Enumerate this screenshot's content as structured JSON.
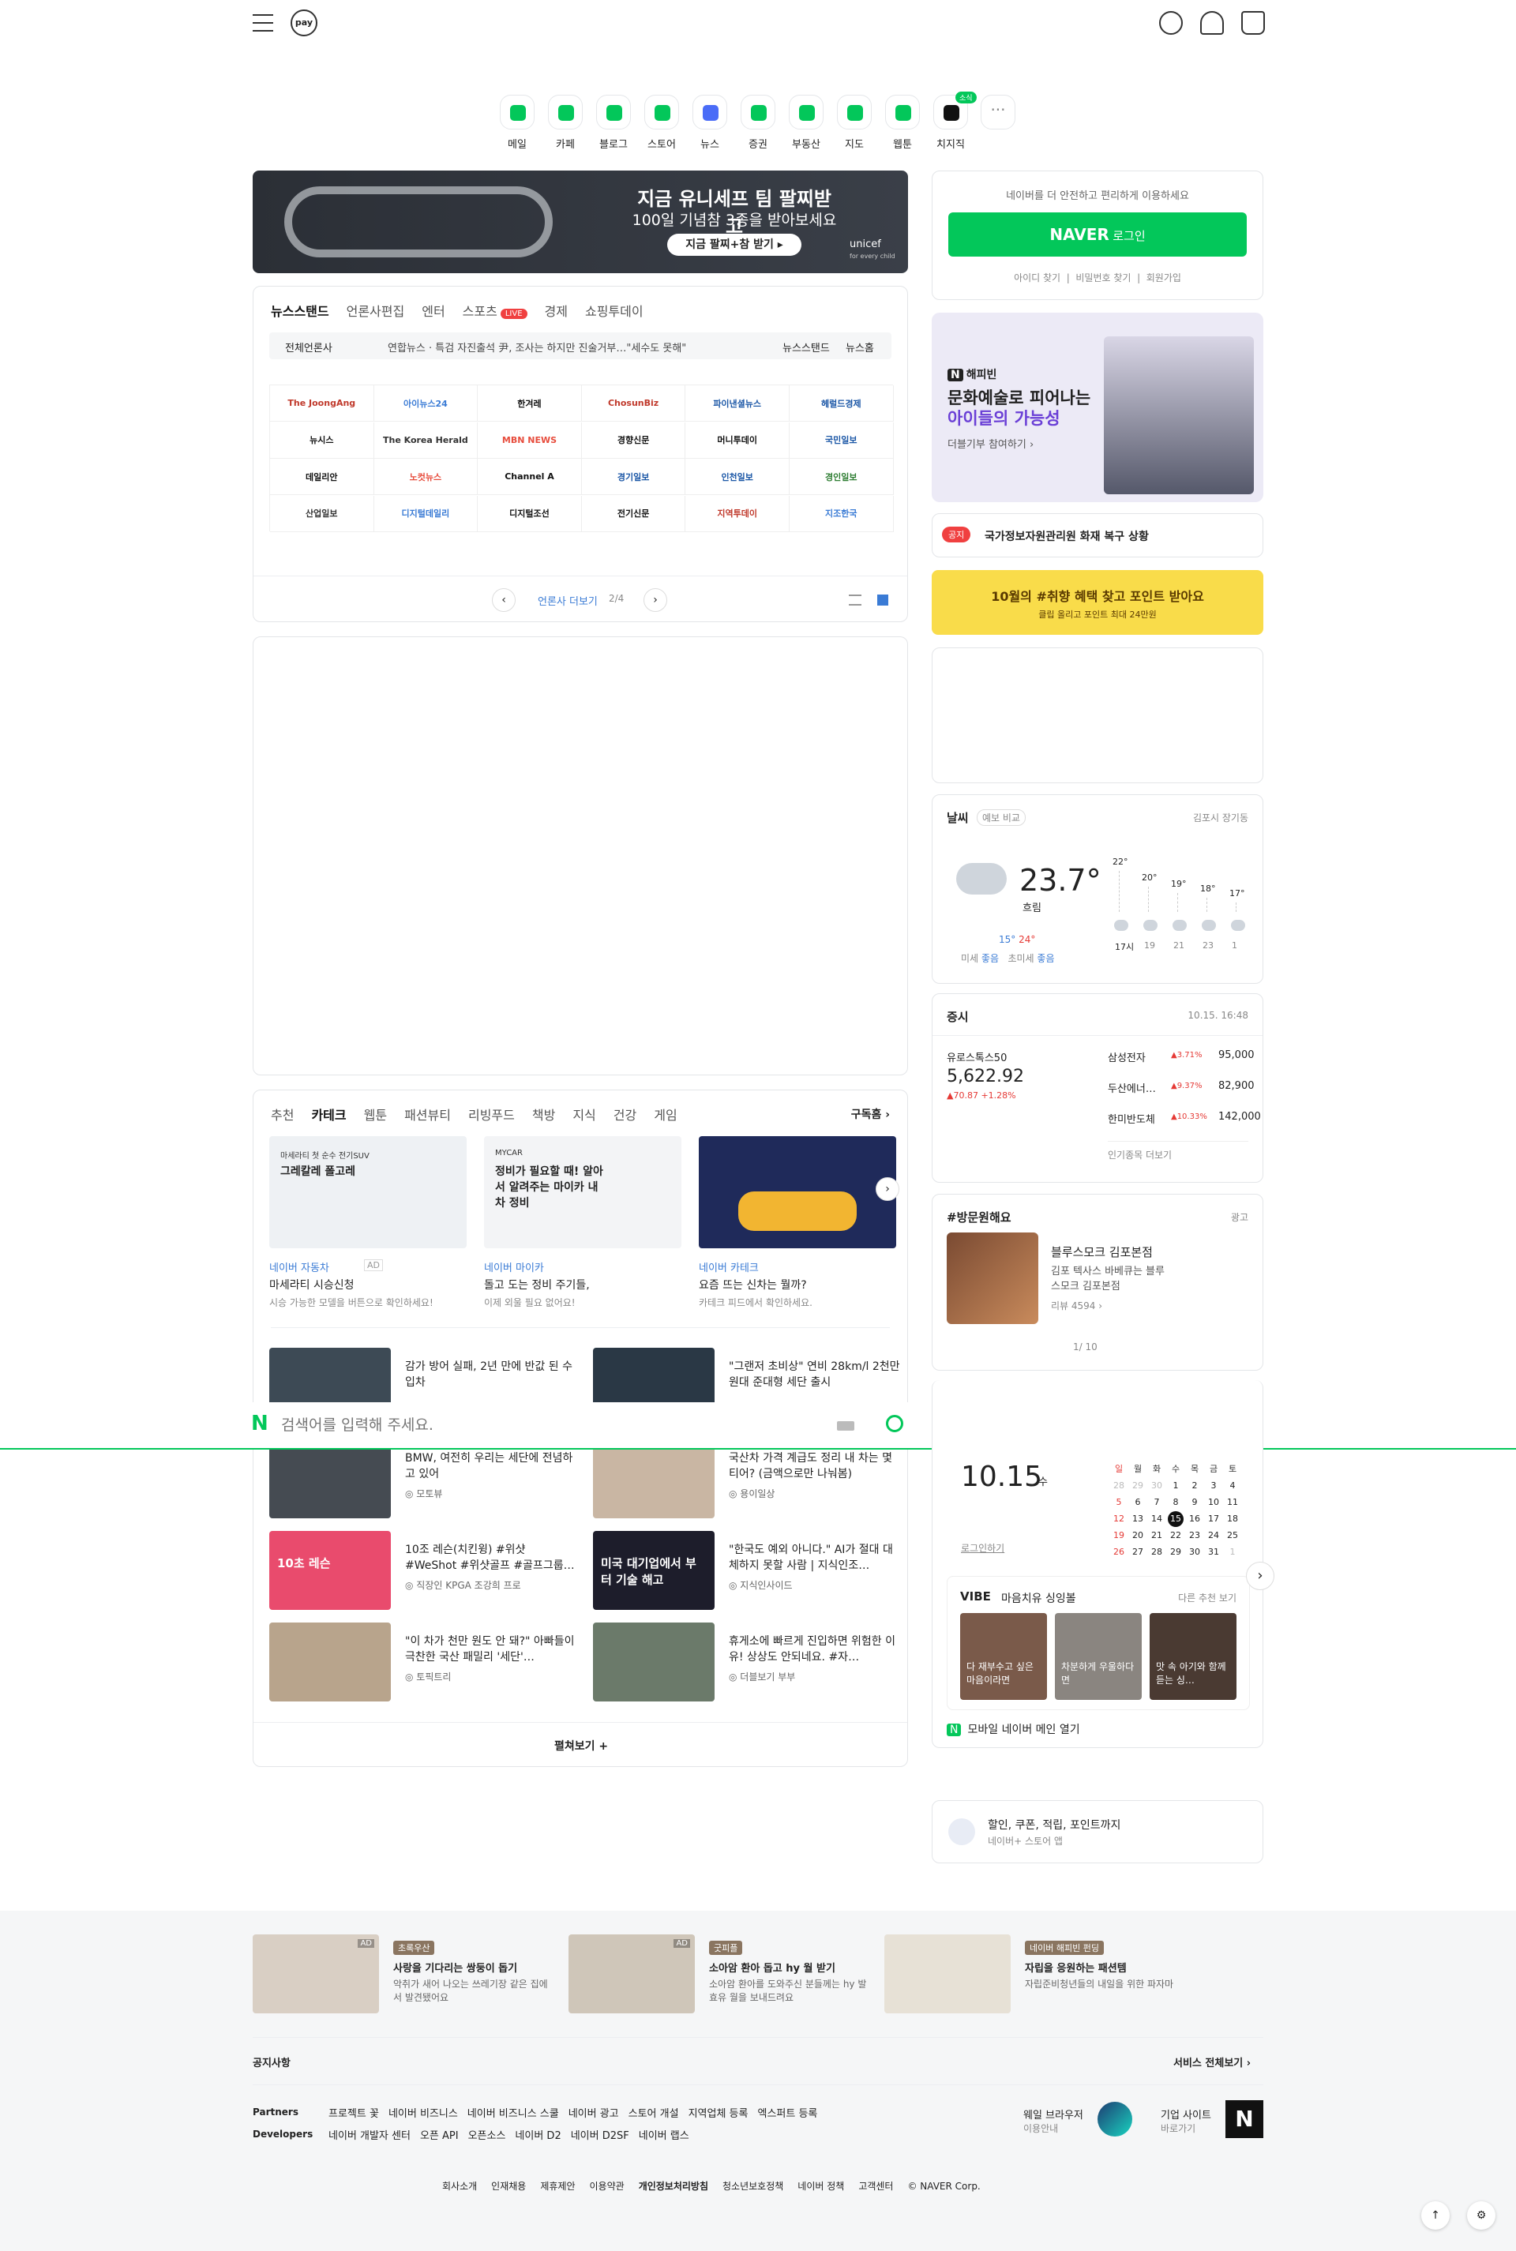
{
  "header": {
    "pay_label": "pay"
  },
  "services": [
    {
      "label": "메일",
      "color": "#03c75a"
    },
    {
      "label": "카페",
      "color": "#03c75a"
    },
    {
      "label": "블로그",
      "color": "#03c75a"
    },
    {
      "label": "스토어",
      "color": "#03c75a"
    },
    {
      "label": "뉴스",
      "color": "#4a6cf7"
    },
    {
      "label": "증권",
      "color": "#03c75a"
    },
    {
      "label": "부동산",
      "color": "#03c75a"
    },
    {
      "label": "지도",
      "color": "#03c75a"
    },
    {
      "label": "웹툰",
      "color": "#03c75a"
    },
    {
      "label": "치지직",
      "color": "#111111"
    }
  ],
  "services_badge": "소식",
  "banner": {
    "title": "지금 유니세프 팀 팔찌받고",
    "subtitle": "100일 기념참 3종을 받아보세요",
    "cta": "지금 팔찌+참 받기 ▸",
    "brand": "unicef",
    "brand_sub": "for every child"
  },
  "login": {
    "info": "네이버를 더 안전하고 편리하게 이용하세요",
    "button_brand": "NAVER",
    "button_label": "로그인",
    "find_id": "아이디 찾기",
    "find_pw": "비밀번호 찾기",
    "signup": "회원가입"
  },
  "news": {
    "tabs": [
      "뉴스스탠드",
      "언론사편집",
      "엔터",
      "스포츠",
      "경제",
      "쇼핑투데이"
    ],
    "live_label": "LIVE",
    "filter": "전체언론사",
    "headline": "연합뉴스 · 특검 자진출석 尹, 조사는 하지만 진술거부…\"세수도 못해\"",
    "link1": "뉴스스탠드",
    "link2": "뉴스홈",
    "logos": [
      "The JoongAng",
      "아이뉴스24",
      "한겨레",
      "ChosunBiz",
      "파이낸셜뉴스",
      "헤럴드경제",
      "뉴시스",
      "The Korea Herald",
      "MBN NEWS",
      "경향신문",
      "머니투데이",
      "국민일보",
      "데일리안",
      "노컷뉴스",
      "Channel A",
      "경기일보",
      "인천일보",
      "경인일보",
      "산업일보",
      "디지털데일리",
      "디지털조선",
      "전기신문",
      "지역투데이",
      "지조한국"
    ],
    "pager_label": "언론사 더보기",
    "pager_count": "2/4"
  },
  "happybean": {
    "brand": "해피빈",
    "line1": "문화예술로 피어나는",
    "line2": "아이들의 가능성",
    "cta": "더블기부 참여하기 ›"
  },
  "notice": {
    "badge": "공지",
    "text": "국가정보자원관리원 화재 복구 상황"
  },
  "promo": {
    "text": "10월의 #취향 혜택 찾고 포인트 받아요",
    "sub": "클립 올리고 포인트 최대 24만원"
  },
  "weather": {
    "title": "날씨",
    "compare": "예보 비교",
    "location": "김포시 장기동",
    "temp": "23.7°",
    "cond": "흐림",
    "low": "15°",
    "high": "24°",
    "dust_label": "미세",
    "dust_val": "좋음",
    "ufine_label": "초미세",
    "ufine_val": "좋음",
    "forecast": [
      {
        "t": "22°",
        "h": "17시"
      },
      {
        "t": "20°",
        "h": "19"
      },
      {
        "t": "19°",
        "h": "21"
      },
      {
        "t": "18°",
        "h": "23"
      },
      {
        "t": "17°",
        "h": "1"
      }
    ]
  },
  "stock": {
    "title": "증시",
    "time": "10.15. 16:48",
    "index_name": "유로스톡스50",
    "index_val": "5,622.92",
    "index_chg": "▲70.87 +1.28%",
    "items": [
      {
        "n": "삼성전자",
        "c": "▲3.71%",
        "v": "95,000"
      },
      {
        "n": "두산에너…",
        "c": "▲9.37%",
        "v": "82,900"
      },
      {
        "n": "한미반도체",
        "c": "▲10.33%",
        "v": "142,000"
      }
    ],
    "more": "인기종목 더보기"
  },
  "visit": {
    "tag": "#방문원해요",
    "ad": "광고",
    "name": "블루스모크 김포본점",
    "desc": "김포 텍사스 바베큐는 블루스모크 김포본점",
    "review": "리뷰 4594 ›",
    "page": "1/ 10"
  },
  "feed": {
    "tabs": [
      "추천",
      "카테크",
      "웹툰",
      "패션뷰티",
      "리빙푸드",
      "책방",
      "지식",
      "건강",
      "게임"
    ],
    "active": "카테크",
    "subscribe": "구독홈 ›",
    "cards": [
      {
        "src": "네이버 자동차",
        "title": "마세라티 시승신청",
        "desc": "시승 가능한 모델을 버튼으로 확인하세요!",
        "img_text": "그레칼레 폴고레",
        "img_sub": "마세라티 첫 순수 전기SUV",
        "ad": "AD"
      },
      {
        "src": "네이버 마이카",
        "title": "돌고 도는 정비 주기들,",
        "desc": "이제 외울 필요 없어요!",
        "img_text": "정비가 필요할 때! 알아서 알려주는 마이카 내 차 정비",
        "img_sub": "MYCAR"
      },
      {
        "src": "네이버 카테크",
        "title": "요즘 뜨는 신차는 뭘까?",
        "desc": "카테크 피드에서 확인하세요."
      }
    ],
    "list": [
      {
        "t": "감가 방어 실패, 2년 만에 반값 된 수입차",
        "a": ""
      },
      {
        "t": "\"그랜저 초비상\" 연비 28km/l 2천만원대 준대형 세단 출시",
        "a": ""
      },
      {
        "t": "BMW, 여전히 우리는 세단에 전념하고 있어",
        "a": "모토뷰"
      },
      {
        "t": "국산차 가격 계급도 정리 내 차는 몇 티어? (금액으로만 나눠봄)",
        "a": "용이일상"
      },
      {
        "t": "10조 레슨(치킨윙) #위샷 #WeShot #위샷골프 #골프그룹…",
        "a": "직장인 KPGA 조강희 프로",
        "img": "10초 레슨"
      },
      {
        "t": "\"한국도 예외 아니다.\" AI가 절대 대체하지 못할 사람 | 지식인조…",
        "a": "지식인사이드",
        "img": "미국 대기업에서 부터 기술 해고"
      },
      {
        "t": "\"이 차가 천만 원도 안 돼?\" 아빠들이 극찬한 국산 패밀리 '세단'…",
        "a": "토픽트리"
      },
      {
        "t": "휴게소에 빠르게 진입하면 위험한 이유! 상상도 안되네요. #자…",
        "a": "더블보기 부부"
      }
    ],
    "more": "펼쳐보기 +"
  },
  "search": {
    "placeholder": "검색어를 입력해 주세요."
  },
  "calendar": {
    "date": "10.15",
    "dow": "수",
    "login": "로그인하기",
    "days": [
      "일",
      "월",
      "화",
      "수",
      "목",
      "금",
      "토"
    ],
    "rows": [
      [
        "28",
        "29",
        "30",
        "1",
        "2",
        "3",
        "4"
      ],
      [
        "5",
        "6",
        "7",
        "8",
        "9",
        "10",
        "11"
      ],
      [
        "12",
        "13",
        "14",
        "15",
        "16",
        "17",
        "18"
      ],
      [
        "19",
        "20",
        "21",
        "22",
        "23",
        "24",
        "25"
      ],
      [
        "26",
        "27",
        "28",
        "29",
        "30",
        "31",
        "1"
      ]
    ]
  },
  "vibe": {
    "brand": "VIBE",
    "title": "마음치유 싱잉볼",
    "more": "다른 추천 보기",
    "items": [
      "다 재부수고 싶은 마음이라면",
      "차분하게 우울하다면",
      "맛 속 아기와 함께 듣는 싱…"
    ]
  },
  "mobile": {
    "text": "모바일 네이버 메인 열기"
  },
  "pay_banner": {
    "title": "할인, 쿠폰, 적립, 포인트까지",
    "sub": "네이버+ 스토어 앱"
  },
  "bottom_ads": [
    {
      "tag": "초록우산",
      "title": "사랑을 기다리는 쌍둥이 돕기",
      "desc": "악취가 새어 나오는 쓰레기장 같은 집에서 발견됐어요",
      "ad": "AD"
    },
    {
      "tag": "굿피플",
      "title": "소아암 환아 돕고 hy 월 받기",
      "desc": "소아암 환아를 도와주신 분들께는 hy 발효유 월을 보내드려요",
      "ad": "AD"
    },
    {
      "tag": "네이버 해피빈 펀딩",
      "title": "자립을 응원하는 패션템",
      "desc": "자립준비청년들의 내일을 위한 파자마"
    }
  ],
  "footer": {
    "notice": "공지사항",
    "all_services": "서비스 전체보기 ›",
    "partners_label": "Partners",
    "partners": [
      "프로젝트 꽃",
      "네이버 비즈니스",
      "네이버 비즈니스 스쿨",
      "네이버 광고",
      "스토어 개설",
      "지역업체 등록",
      "엑스퍼트 등록"
    ],
    "dev_label": "Developers",
    "developers": [
      "네이버 개발자 센터",
      "오픈 API",
      "오픈소스",
      "네이버 D2",
      "네이버 D2SF",
      "네이버 랩스"
    ],
    "whale_title": "웨일 브라우저",
    "whale_sub": "이용안내",
    "corp_title": "기업 사이트",
    "corp_sub": "바로가기",
    "links": [
      "회사소개",
      "인재채용",
      "제휴제안",
      "이용약관",
      "개인정보처리방침",
      "청소년보호정책",
      "네이버 정책",
      "고객센터"
    ],
    "copyright": "© NAVER Corp."
  }
}
